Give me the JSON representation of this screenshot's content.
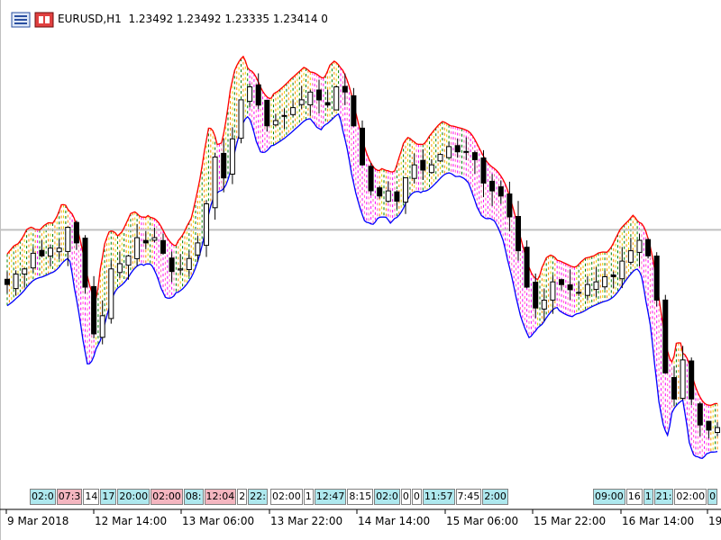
{
  "header": {
    "symbol": "EURUSD,H1",
    "open": "1.23492",
    "high": "1.23492",
    "low": "1.23335",
    "close": "1.23414",
    "volume": "0"
  },
  "chart_data": {
    "type": "candlestick",
    "symbol": "EURUSD",
    "timeframe": "H1",
    "x_tick_labels": [
      "9 Mar 2018",
      "12 Mar 14:00",
      "13 Mar 06:00",
      "13 Mar 22:00",
      "14 Mar 14:00",
      "15 Mar 06:00",
      "15 Mar 22:00",
      "16 Mar 14:00",
      "19"
    ],
    "ylim": [
      1.2275,
      1.2448
    ],
    "horizontal_line": 1.237,
    "grid": false,
    "colors": {
      "candle": "#000000",
      "upper_band": "#ff0000",
      "lower_band": "#0000ff",
      "hline": "#c0c0c0",
      "fill_up": [
        "#008000",
        "#ff8c00",
        "#e6d200"
      ],
      "fill_down": [
        "#ff00ff",
        "#ff69b4"
      ],
      "tag_blue": "#aee8ee",
      "tag_pink": "#f4b6c0"
    },
    "closes": [
      1.2349,
      1.2353,
      1.2355,
      1.2361,
      1.236,
      1.2363,
      1.2363,
      1.2371,
      1.2365,
      1.2348,
      1.233,
      1.2337,
      1.2355,
      1.2357,
      1.236,
      1.2367,
      1.2365,
      1.2367,
      1.2361,
      1.2354,
      1.2355,
      1.2359,
      1.2365,
      1.238,
      1.2398,
      1.239,
      1.2405,
      1.242,
      1.2425,
      1.2418,
      1.241,
      1.2412,
      1.2414,
      1.2417,
      1.242,
      1.2423,
      1.242,
      1.2418,
      1.2425,
      1.2423,
      1.241,
      1.2395,
      1.2385,
      1.2383,
      1.2385,
      1.2381,
      1.239,
      1.2395,
      1.2393,
      1.2395,
      1.2399,
      1.2402,
      1.24,
      1.24,
      1.2397,
      1.2388,
      1.2385,
      1.2383,
      1.2375,
      1.2362,
      1.2348,
      1.234,
      1.2343,
      1.235,
      1.2349,
      1.2347,
      1.2346,
      1.2349,
      1.235,
      1.2352,
      1.2352,
      1.2358,
      1.2362,
      1.2366,
      1.236,
      1.2343,
      1.2315,
      1.2305,
      1.232,
      1.2305,
      1.2295,
      1.2293,
      1.2294
    ],
    "tags": [
      {
        "label": "02:0",
        "color": "blue"
      },
      {
        "label": "07:3",
        "color": "pink"
      },
      {
        "label": "14",
        "color": "none"
      },
      {
        "label": "17",
        "color": "blue"
      },
      {
        "label": "20:00",
        "color": "blue"
      },
      {
        "label": "02:00",
        "color": "pink"
      },
      {
        "label": "08:",
        "color": "blue"
      },
      {
        "label": "12:04",
        "color": "pink"
      },
      {
        "label": "2",
        "color": "none"
      },
      {
        "label": "22:",
        "color": "blue"
      },
      {
        "label": "02:00",
        "color": "none"
      },
      {
        "label": "1",
        "color": "none"
      },
      {
        "label": "12:47",
        "color": "blue"
      },
      {
        "label": "8:15",
        "color": "none"
      },
      {
        "label": "02:0",
        "color": "blue"
      },
      {
        "label": "0",
        "color": "none"
      },
      {
        "label": "0",
        "color": "none"
      },
      {
        "label": "11:57",
        "color": "blue"
      },
      {
        "label": "7:45",
        "color": "none"
      },
      {
        "label": "2:00",
        "color": "blue"
      },
      {
        "label": "09:00",
        "color": "blue"
      },
      {
        "label": "16",
        "color": "none"
      },
      {
        "label": "1",
        "color": "blue"
      },
      {
        "label": "21:",
        "color": "blue"
      },
      {
        "label": "02:00",
        "color": "none"
      },
      {
        "label": "0",
        "color": "blue"
      }
    ]
  }
}
